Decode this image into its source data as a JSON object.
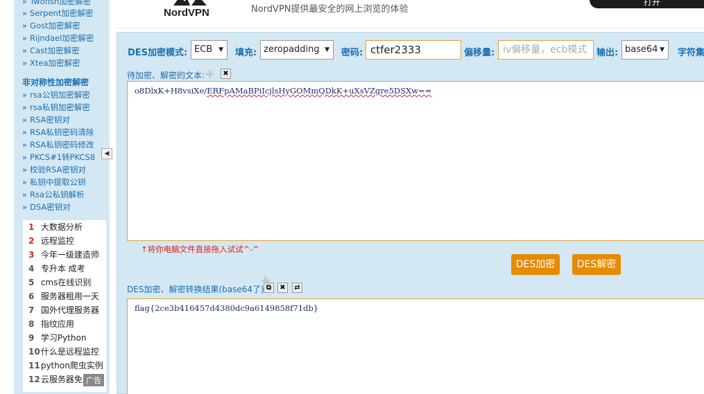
{
  "sidebar": {
    "items_top": [
      {
        "label": "Twofish加密解密"
      },
      {
        "label": "Serpent加密解密"
      },
      {
        "label": "Gost加密解密"
      },
      {
        "label": "Rijndael加密解密"
      },
      {
        "label": "Cast加密解密"
      },
      {
        "label": "Xtea加密解密"
      }
    ],
    "asym_heading": "非对称性加密解密",
    "items_asym": [
      {
        "label": "rsa公钥加密解密"
      },
      {
        "label": "rsa私钥加密解密"
      },
      {
        "label": "RSA密钥对"
      },
      {
        "label": "RSA私钥密码清除"
      },
      {
        "label": "RSA私钥密码修改"
      },
      {
        "label": "PKCS#1转PKCS8"
      },
      {
        "label": "校验RSA密钥对"
      },
      {
        "label": "私钥中提取公钥"
      },
      {
        "label": "Rsa公私钥解析"
      },
      {
        "label": "DSA密钥对"
      }
    ],
    "bullet": "»",
    "collapse_glyph": "◀",
    "rankings": [
      {
        "num": "1",
        "label": "大数据分析",
        "hot": true
      },
      {
        "num": "2",
        "label": "远程监控",
        "hot": true
      },
      {
        "num": "3",
        "label": "今年一级建造师",
        "hot": true
      },
      {
        "num": "4",
        "label": "专升本 成考",
        "hot": false
      },
      {
        "num": "5",
        "label": "cms在线识别",
        "hot": false
      },
      {
        "num": "6",
        "label": "服务器租用一天",
        "hot": false
      },
      {
        "num": "7",
        "label": "国外代理服务器",
        "hot": false
      },
      {
        "num": "8",
        "label": "指纹应用",
        "hot": false
      },
      {
        "num": "9",
        "label": "学习Python",
        "hot": false
      },
      {
        "num": "10",
        "label": "什么是远程监控",
        "hot": false
      },
      {
        "num": "11",
        "label": "python爬虫实例",
        "hot": false
      },
      {
        "num": "12",
        "label": "云服务器免费",
        "hot": false
      }
    ],
    "ad_tag": "广告"
  },
  "header": {
    "logo_text": "NordVPN",
    "tagline": "NordVPN提供最安全的网上浏览的体验",
    "cta_label": "打开"
  },
  "form": {
    "mode_label": "DES加密模式:",
    "mode_value": "ECB",
    "padding_label": "填充:",
    "padding_value": "zeropadding",
    "password_label": "密码:",
    "password_value": "ctfer2333",
    "offset_label": "偏移量:",
    "offset_placeholder": "iv偏移量，ecb模式",
    "output_label": "输出:",
    "output_value": "base64",
    "charset_label": "字符集"
  },
  "input_section": {
    "label": "待加密、解密的文本:",
    "clear_glyph": "✖",
    "text_plain_prefix": "o8DlxK+H8vsiXe/",
    "text_underlined": "ERFpAMaBPiIcjlsHyGOMmQDkK+uXsVZgre5DSXw==",
    "drag_hint": "↑将你电脑文件直接拖入试试^-^"
  },
  "actions": {
    "encrypt_label": "DES加密",
    "decrypt_label": "DES解密"
  },
  "output_section": {
    "label": "DES加密、解密转换结果(base64了):",
    "copy_glyph": "⧉",
    "clear_glyph": "✖",
    "swap_glyph": "⇄",
    "result_text": "flag{2ce3b416457d4380dc9a6149858f71db}"
  },
  "colors": {
    "panel_bg": "#d4e8f3",
    "accent_orange": "#e68a00",
    "link_blue": "#1a6fb0",
    "hot_red": "#d9251d"
  }
}
